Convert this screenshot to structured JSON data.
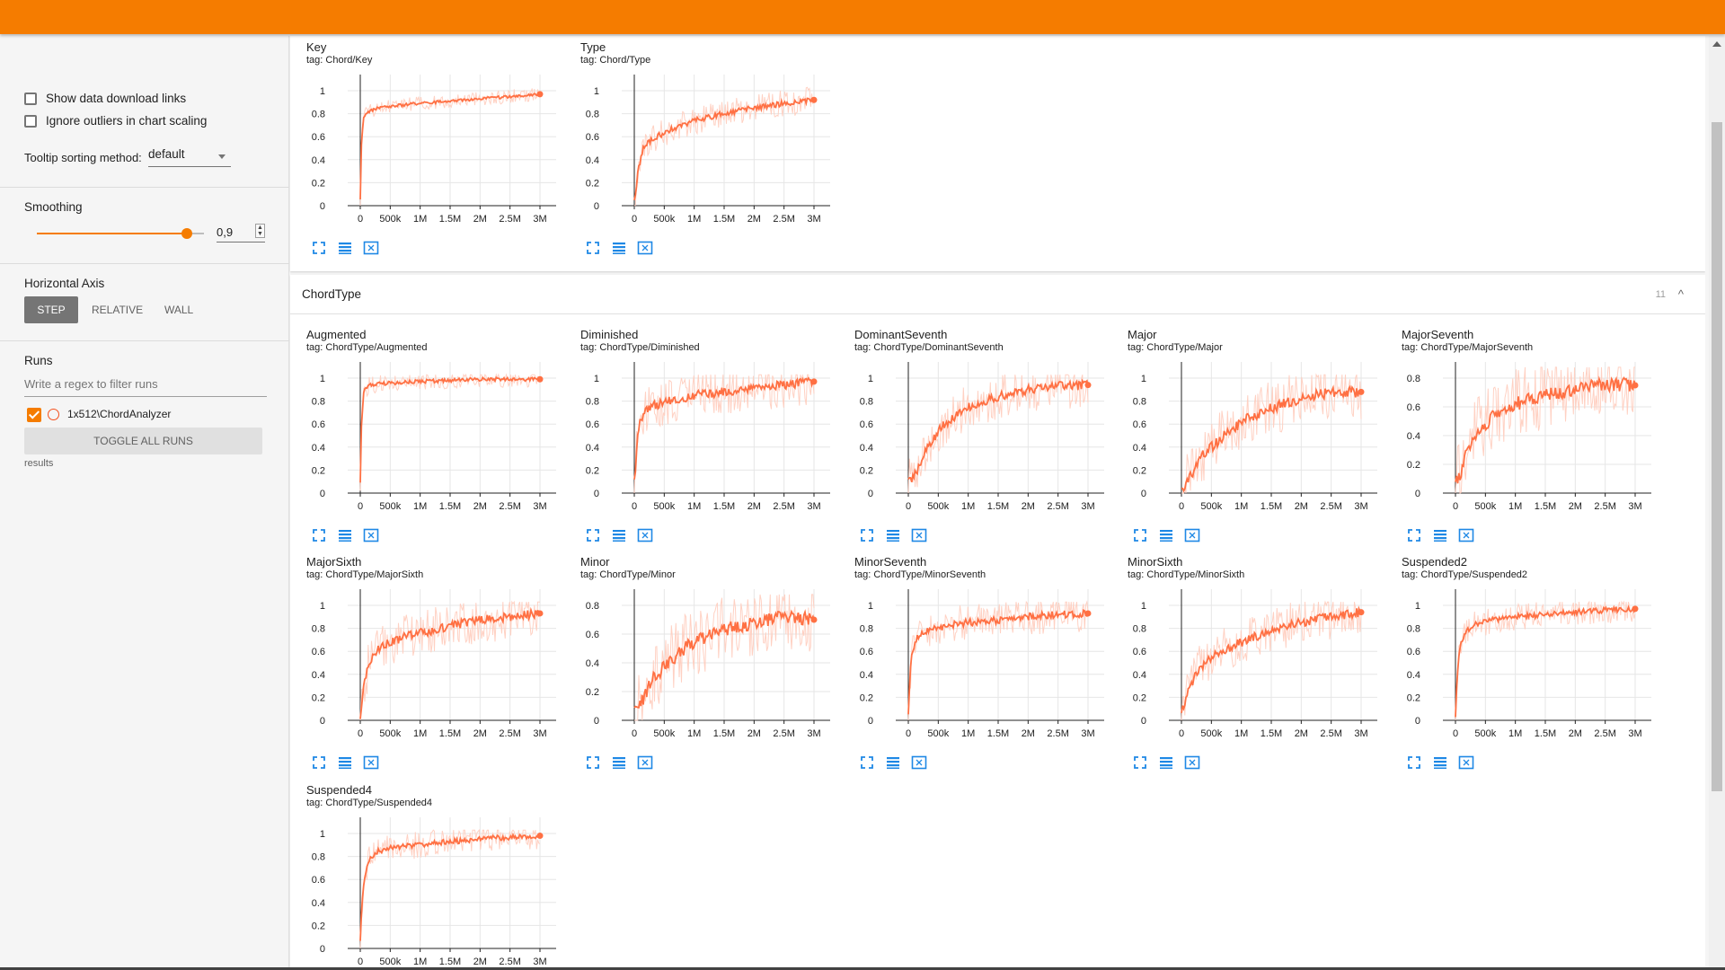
{
  "colors": {
    "accent": "#f57c00",
    "series": "#ff7043",
    "series_light": "#ffccbc"
  },
  "sidebar": {
    "show_download": "Show data download links",
    "ignore_outliers": "Ignore outliers in chart scaling",
    "tooltip_label": "Tooltip sorting method:",
    "tooltip_value": "default",
    "smoothing_label": "Smoothing",
    "smoothing_value": "0,9",
    "smoothing_level": 0.9,
    "haxis_label": "Horizontal Axis",
    "haxis_options": [
      "STEP",
      "RELATIVE",
      "WALL"
    ],
    "runs_label": "Runs",
    "filter_placeholder": "Write a regex to filter runs",
    "run_name": "1x512\\ChordAnalyzer",
    "toggle_all": "TOGGLE ALL RUNS",
    "results": "results"
  },
  "group": {
    "name": "ChordType",
    "count": "11"
  },
  "chart_data": [
    {
      "title": "Key",
      "tag": "tag: Chord/Key",
      "type": "line",
      "ticks": [
        "1",
        "0.8",
        "0.6",
        "0.4",
        "0.2",
        "0"
      ],
      "ylim": [
        0,
        1
      ],
      "x": [
        0,
        20000,
        60000,
        150000,
        300000,
        600000,
        1000000,
        1500000,
        2000000,
        2500000,
        3000000
      ],
      "values": [
        0.05,
        0.55,
        0.78,
        0.82,
        0.85,
        0.87,
        0.89,
        0.91,
        0.93,
        0.95,
        0.97
      ],
      "noise": 0.015
    },
    {
      "title": "Type",
      "tag": "tag: Chord/Type",
      "type": "line",
      "ticks": [
        "1",
        "0.8",
        "0.6",
        "0.4",
        "0.2",
        "0"
      ],
      "ylim": [
        0,
        1
      ],
      "x": [
        0,
        20000,
        60000,
        150000,
        300000,
        600000,
        1000000,
        1500000,
        2000000,
        2500000,
        3000000
      ],
      "values": [
        0.05,
        0.1,
        0.3,
        0.5,
        0.58,
        0.66,
        0.74,
        0.8,
        0.85,
        0.89,
        0.92
      ],
      "noise": 0.03
    },
    {
      "title": "Augmented",
      "tag": "tag: ChordType/Augmented",
      "type": "line",
      "ticks": [
        "1",
        "0.8",
        "0.6",
        "0.4",
        "0.2",
        "0"
      ],
      "ylim": [
        0,
        1
      ],
      "x": [
        0,
        20000,
        60000,
        150000,
        300000,
        600000,
        1000000,
        1500000,
        2000000,
        2500000,
        3000000
      ],
      "values": [
        0.1,
        0.6,
        0.9,
        0.94,
        0.95,
        0.96,
        0.97,
        0.98,
        0.99,
        0.99,
        0.99
      ],
      "noise": 0.02
    },
    {
      "title": "Diminished",
      "tag": "tag: ChordType/Diminished",
      "type": "line",
      "ticks": [
        "1",
        "0.8",
        "0.6",
        "0.4",
        "0.2",
        "0"
      ],
      "ylim": [
        0,
        1
      ],
      "x": [
        0,
        20000,
        60000,
        150000,
        300000,
        600000,
        1000000,
        1500000,
        2000000,
        2500000,
        3000000
      ],
      "values": [
        0.08,
        0.2,
        0.55,
        0.7,
        0.76,
        0.8,
        0.85,
        0.88,
        0.91,
        0.94,
        0.97
      ],
      "noise": 0.05
    },
    {
      "title": "DominantSeventh",
      "tag": "tag: ChordType/DominantSeventh",
      "type": "line",
      "ticks": [
        "1",
        "0.8",
        "0.6",
        "0.4",
        "0.2",
        "0"
      ],
      "ylim": [
        0,
        1
      ],
      "x": [
        0,
        20000,
        60000,
        150000,
        300000,
        600000,
        1000000,
        1500000,
        2000000,
        2500000,
        3000000
      ],
      "values": [
        0.1,
        0.1,
        0.12,
        0.2,
        0.4,
        0.6,
        0.75,
        0.84,
        0.9,
        0.93,
        0.94
      ],
      "noise": 0.05
    },
    {
      "title": "Major",
      "tag": "tag: ChordType/Major",
      "type": "line",
      "ticks": [
        "1",
        "0.8",
        "0.6",
        "0.4",
        "0.2",
        "0"
      ],
      "ylim": [
        0,
        1
      ],
      "x": [
        0,
        20000,
        60000,
        150000,
        300000,
        600000,
        1000000,
        1500000,
        2000000,
        2500000,
        3000000
      ],
      "values": [
        0.04,
        0.05,
        0.08,
        0.15,
        0.3,
        0.45,
        0.62,
        0.74,
        0.82,
        0.88,
        0.88
      ],
      "noise": 0.06
    },
    {
      "title": "MajorSeventh",
      "tag": "tag: ChordType/MajorSeventh",
      "type": "line",
      "ticks": [
        "0.8",
        "0.6",
        "0.4",
        "0.2",
        "0"
      ],
      "ylim": [
        0,
        0.85
      ],
      "x": [
        0,
        20000,
        60000,
        150000,
        300000,
        600000,
        1000000,
        1500000,
        2000000,
        2500000,
        3000000
      ],
      "values": [
        0.1,
        0.08,
        0.1,
        0.25,
        0.4,
        0.52,
        0.62,
        0.68,
        0.72,
        0.76,
        0.75
      ],
      "noise": 0.06
    },
    {
      "title": "MajorSixth",
      "tag": "tag: ChordType/MajorSixth",
      "type": "line",
      "ticks": [
        "1",
        "0.8",
        "0.6",
        "0.4",
        "0.2",
        "0"
      ],
      "ylim": [
        0,
        1
      ],
      "x": [
        0,
        20000,
        60000,
        150000,
        300000,
        600000,
        1000000,
        1500000,
        2000000,
        2500000,
        3000000
      ],
      "values": [
        0.05,
        0.12,
        0.3,
        0.5,
        0.62,
        0.7,
        0.76,
        0.82,
        0.87,
        0.9,
        0.93
      ],
      "noise": 0.05
    },
    {
      "title": "Minor",
      "tag": "tag: ChordType/Minor",
      "type": "line",
      "ticks": [
        "0.8",
        "0.6",
        "0.4",
        "0.2",
        "0"
      ],
      "ylim": [
        0,
        0.85
      ],
      "x": [
        0,
        20000,
        60000,
        150000,
        300000,
        600000,
        1000000,
        1500000,
        2000000,
        2500000,
        3000000
      ],
      "values": [
        0.06,
        0.06,
        0.08,
        0.15,
        0.28,
        0.42,
        0.55,
        0.63,
        0.68,
        0.72,
        0.7
      ],
      "noise": 0.06
    },
    {
      "title": "MinorSeventh",
      "tag": "tag: ChordType/MinorSeventh",
      "type": "line",
      "ticks": [
        "1",
        "0.8",
        "0.6",
        "0.4",
        "0.2",
        "0"
      ],
      "ylim": [
        0,
        1
      ],
      "x": [
        0,
        20000,
        60000,
        150000,
        300000,
        600000,
        1000000,
        1500000,
        2000000,
        2500000,
        3000000
      ],
      "values": [
        0.05,
        0.3,
        0.6,
        0.72,
        0.78,
        0.82,
        0.85,
        0.87,
        0.9,
        0.92,
        0.93
      ],
      "noise": 0.04
    },
    {
      "title": "MinorSixth",
      "tag": "tag: ChordType/MinorSixth",
      "type": "line",
      "ticks": [
        "1",
        "0.8",
        "0.6",
        "0.4",
        "0.2",
        "0"
      ],
      "ylim": [
        0,
        1
      ],
      "x": [
        0,
        20000,
        60000,
        150000,
        300000,
        600000,
        1000000,
        1500000,
        2000000,
        2500000,
        3000000
      ],
      "values": [
        0.08,
        0.1,
        0.15,
        0.3,
        0.45,
        0.58,
        0.68,
        0.78,
        0.85,
        0.9,
        0.94
      ],
      "noise": 0.05
    },
    {
      "title": "Suspended2",
      "tag": "tag: ChordType/Suspended2",
      "type": "line",
      "ticks": [
        "1",
        "0.8",
        "0.6",
        "0.4",
        "0.2",
        "0"
      ],
      "ylim": [
        0,
        1
      ],
      "x": [
        0,
        20000,
        60000,
        150000,
        300000,
        600000,
        1000000,
        1500000,
        2000000,
        2500000,
        3000000
      ],
      "values": [
        0.05,
        0.3,
        0.6,
        0.76,
        0.83,
        0.87,
        0.9,
        0.92,
        0.94,
        0.96,
        0.97
      ],
      "noise": 0.03
    },
    {
      "title": "Suspended4",
      "tag": "tag: ChordType/Suspended4",
      "type": "line",
      "ticks": [
        "1",
        "0.8",
        "0.6",
        "0.4",
        "0.2",
        "0"
      ],
      "ylim": [
        0,
        1
      ],
      "x": [
        0,
        20000,
        60000,
        150000,
        300000,
        600000,
        1000000,
        1500000,
        2000000,
        2500000,
        3000000
      ],
      "values": [
        0.05,
        0.3,
        0.6,
        0.78,
        0.85,
        0.88,
        0.9,
        0.93,
        0.95,
        0.97,
        0.98
      ],
      "noise": 0.03
    }
  ],
  "x_ticks": [
    "0",
    "500k",
    "1M",
    "1.5M",
    "2M",
    "2.5M",
    "3M"
  ],
  "x_tick_values": [
    0,
    500000,
    1000000,
    1500000,
    2000000,
    2500000,
    3000000
  ],
  "chart_icons": [
    "fullscreen-icon",
    "list-icon",
    "fit-domain-icon"
  ]
}
